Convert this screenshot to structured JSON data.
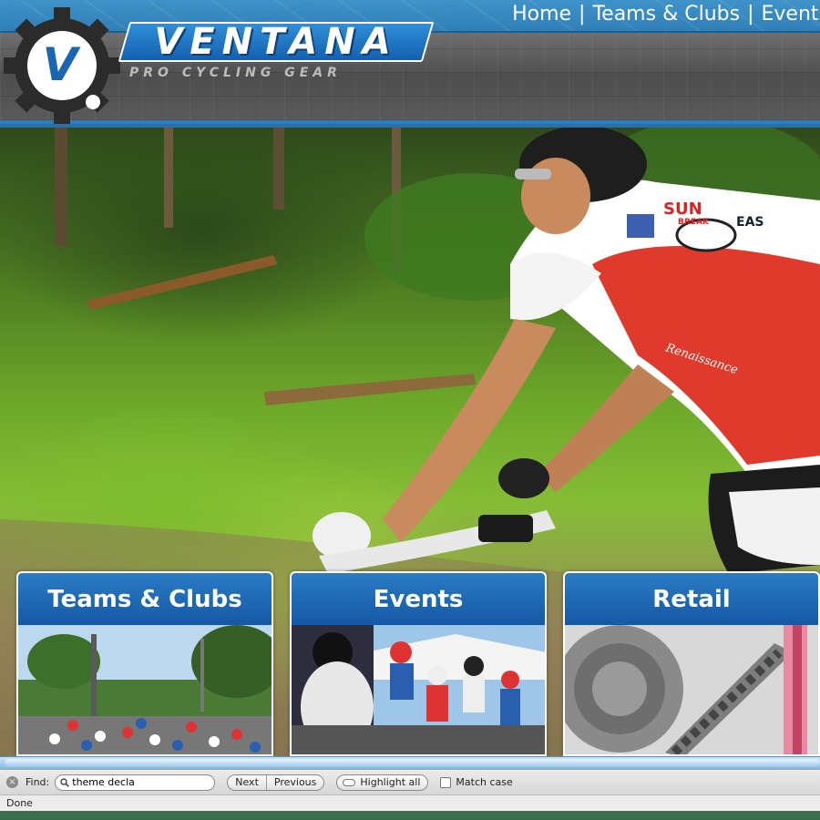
{
  "nav": {
    "links": [
      "Home",
      "Teams & Clubs",
      "Events"
    ],
    "separator": "|"
  },
  "logo": {
    "gear_letter": "V",
    "brand": "VENTANA",
    "tagline": "PRO CYCLING GEAR"
  },
  "hero": {
    "jersey_text": [
      "SUN",
      "BREAK",
      "EAS",
      "Renaissance"
    ]
  },
  "cards": [
    {
      "title": "Teams & Clubs"
    },
    {
      "title": "Events"
    },
    {
      "title": "Retail"
    }
  ],
  "findbar": {
    "label": "Find:",
    "query": "theme decla",
    "next": "Next",
    "previous": "Previous",
    "highlight_all": "Highlight all",
    "match_case": "Match case"
  },
  "status": {
    "text": "Done"
  },
  "colors": {
    "brand_blue": "#1a66b3",
    "nav_blue": "#3a8cc4",
    "header_gray": "#5a5a5a"
  }
}
